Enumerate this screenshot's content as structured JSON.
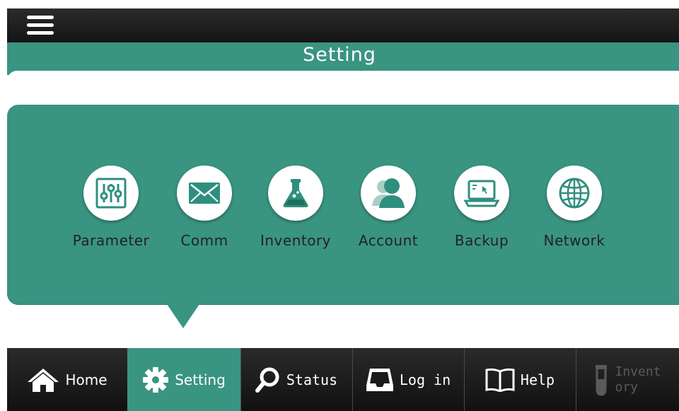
{
  "header": {
    "title": "Setting"
  },
  "menu": {
    "items": [
      {
        "label": "Parameter",
        "icon": "sliders-icon"
      },
      {
        "label": "Comm",
        "icon": "envelope-icon"
      },
      {
        "label": "Inventory",
        "icon": "flask-icon"
      },
      {
        "label": "Account",
        "icon": "users-icon"
      },
      {
        "label": "Backup",
        "icon": "laptop-icon"
      },
      {
        "label": "Network",
        "icon": "globe-icon"
      }
    ]
  },
  "bottom_nav": {
    "items": [
      {
        "label": "Home",
        "icon": "home-icon"
      },
      {
        "label": "Setting",
        "icon": "gear-icon",
        "active": true
      },
      {
        "label": "Status",
        "icon": "search-icon"
      },
      {
        "label": "Log in",
        "icon": "inbox-icon"
      },
      {
        "label": "Help",
        "icon": "book-icon"
      },
      {
        "label": "Invent\nory",
        "icon": "test-tube-icon",
        "disabled": true
      }
    ]
  },
  "colors": {
    "accent": "#3a9482",
    "bar": "#1a1a1a",
    "icon": "#2f8f7f"
  }
}
